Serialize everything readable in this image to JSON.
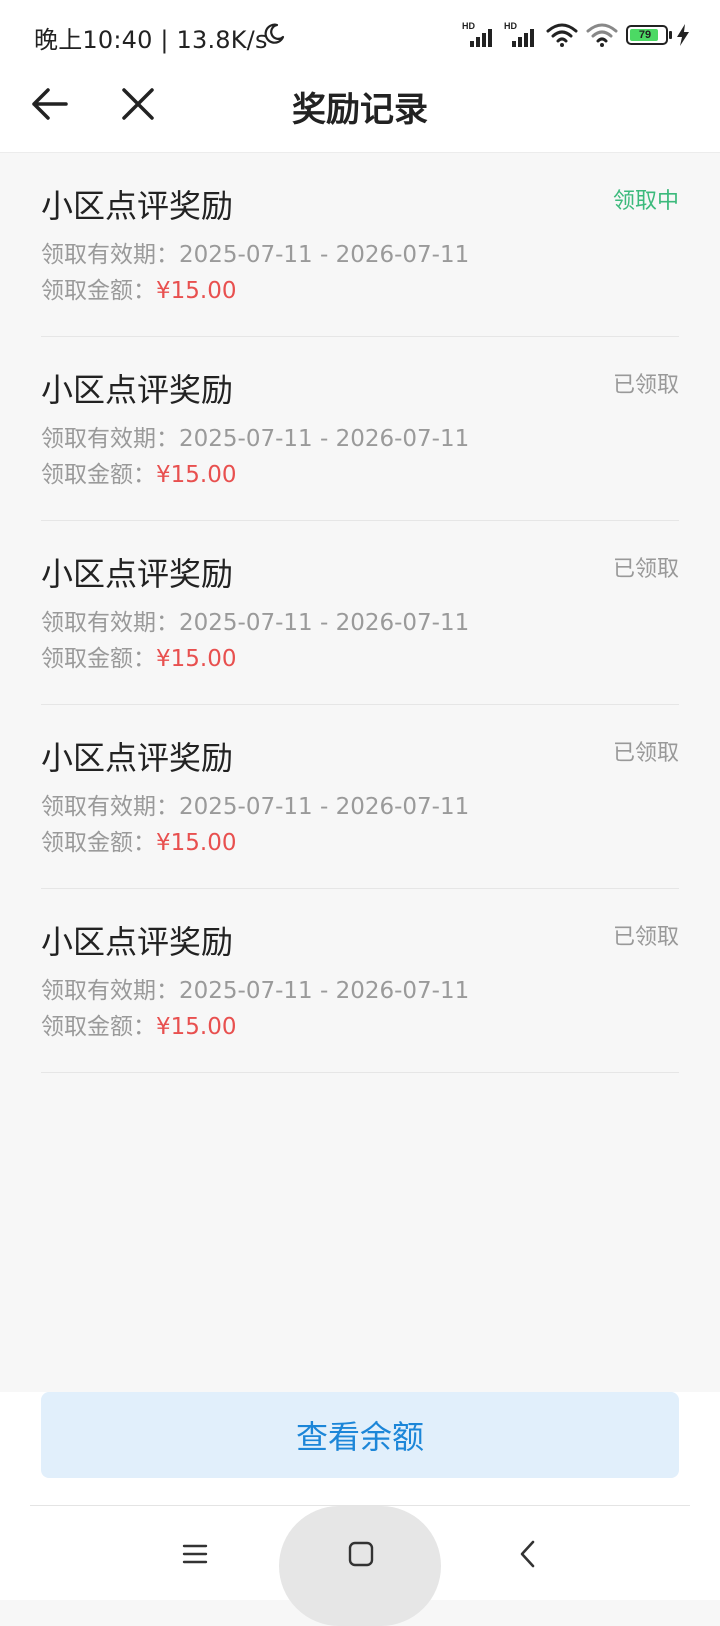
{
  "status_bar": {
    "time_text": "晚上10:40 | 13.8K/s",
    "battery_level": "79",
    "icons": [
      "moon-icon",
      "signal-hd-icon",
      "signal-hd-icon",
      "wifi-icon",
      "wifi-icon",
      "battery-icon",
      "charging-icon"
    ],
    "battery_color": "#4cd964"
  },
  "header": {
    "title": "奖励记录",
    "back_icon": "arrow-left-icon",
    "close_icon": "close-icon"
  },
  "records": [
    {
      "title": "小区点评奖励",
      "status": "领取中",
      "validity_label": "领取有效期：",
      "validity_value": "2025-07-11 - 2026-07-11",
      "amount_label": "领取金额：",
      "amount_value": "¥15.00"
    },
    {
      "title": "小区点评奖励",
      "status": "已领取",
      "validity_label": "领取有效期：",
      "validity_value": "2025-07-11 - 2026-07-11",
      "amount_label": "领取金额：",
      "amount_value": "¥15.00"
    },
    {
      "title": "小区点评奖励",
      "status": "已领取",
      "validity_label": "领取有效期：",
      "validity_value": "2025-07-11 - 2026-07-11",
      "amount_label": "领取金额：",
      "amount_value": "¥15.00"
    },
    {
      "title": "小区点评奖励",
      "status": "已领取",
      "validity_label": "领取有效期：",
      "validity_value": "2025-07-11 - 2026-07-11",
      "amount_label": "领取金额：",
      "amount_value": "¥15.00"
    },
    {
      "title": "小区点评奖励",
      "status": "已领取",
      "validity_label": "领取有效期：",
      "validity_value": "2025-07-11 - 2026-07-11",
      "amount_label": "领取金额：",
      "amount_value": "¥15.00"
    }
  ],
  "colors": {
    "status_active": "#3cba7c",
    "status_done": "#999999",
    "amount": "#e8504f",
    "button_bg": "#e1effb",
    "button_text": "#1c86d8"
  },
  "bottom": {
    "balance_button_label": "查看余额"
  },
  "nav": {
    "icons": [
      "menu-icon",
      "home-icon",
      "back-icon"
    ]
  }
}
